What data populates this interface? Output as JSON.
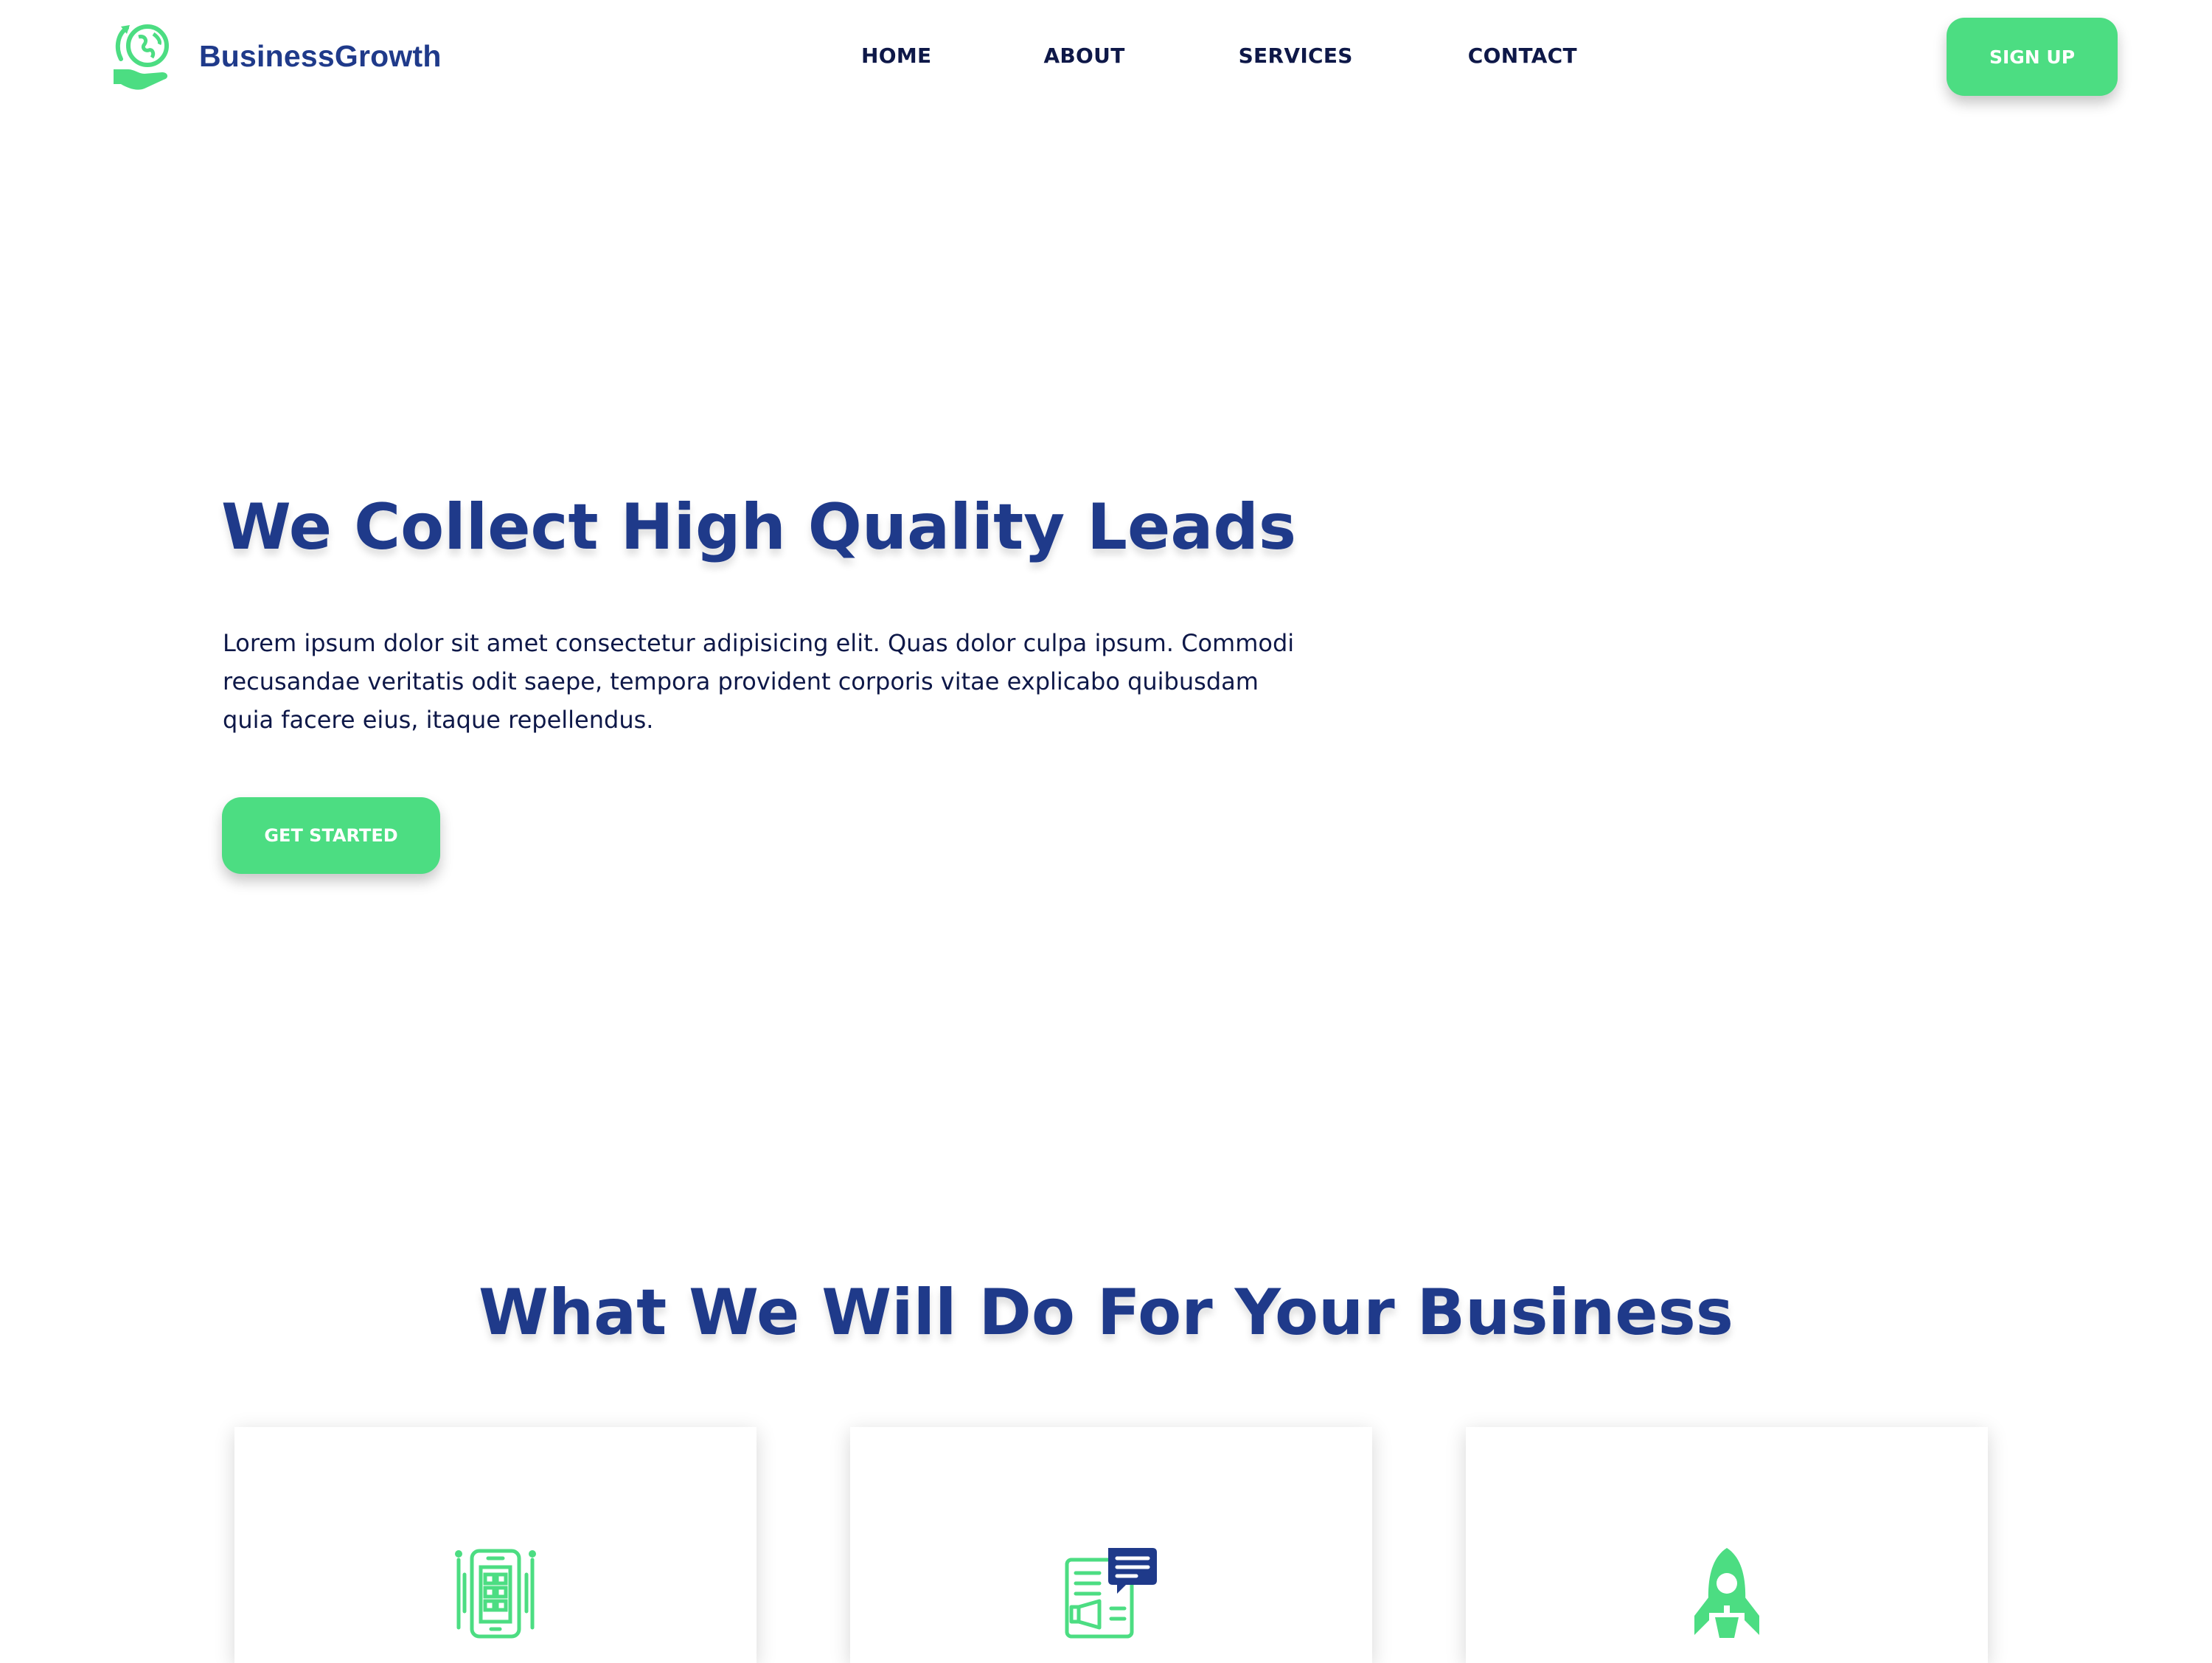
{
  "brand": {
    "name": "BusinessGrowth",
    "logo_icon": "globe-in-hand-icon"
  },
  "nav": {
    "items": [
      {
        "label": "HOME"
      },
      {
        "label": "ABOUT"
      },
      {
        "label": "SERVICES"
      },
      {
        "label": "CONTACT"
      }
    ]
  },
  "header": {
    "signup_label": "SIGN UP"
  },
  "hero": {
    "title": "We Collect High Quality Leads",
    "text": "Lorem ipsum dolor sit amet consectetur adipisicing elit. Quas dolor culpa ipsum. Commodi recusandae veritatis odit saepe, tempora provident corporis vitae explicabo quibusdam quia facere eius, itaque repellendus.",
    "cta_label": "GET STARTED"
  },
  "services": {
    "title": "What We Will Do For Your Business",
    "cards": [
      {
        "icon": "mobile-app-icon"
      },
      {
        "icon": "marketing-megaphone-icon"
      },
      {
        "icon": "rocket-icon"
      }
    ]
  },
  "colors": {
    "primary_navy": "#1f3a8a",
    "text_dark": "#0e1848",
    "accent_green": "#4cdd82",
    "background": "#ffffff"
  }
}
